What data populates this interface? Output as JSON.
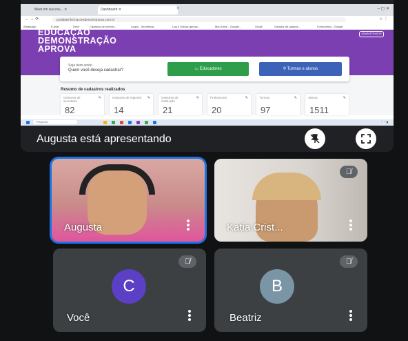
{
  "browser": {
    "tabs": [
      "Meet em sua reu...",
      "Dashboard"
    ],
    "url": "portaldeinformacoesdemonstracao.com.br",
    "bookmarks": [
      "WhatsApp",
      "E-mail",
      "Drive",
      "Cadastro de servido...",
      "Logon - Secretaria...",
      "Log it | Iniciar gerenc...",
      "Meu Drive - Google...",
      "Gmail",
      "Gerador de palavra...",
      "Formulários - Google"
    ]
  },
  "site": {
    "title": "EDUCAÇÃO\nDEMONSTRAÇÃO\nAPROVA",
    "account_button": "ADMINISTRADOR",
    "greeting": "Seja bem-vindo",
    "question": "Quem você deseja cadastrar?",
    "btn_educadores": "Educadores",
    "btn_turmas": "Turmas e alunos",
    "resumo_title": "Resumo de cadastros realizados",
    "stats": [
      {
        "label": "Gestores de secretaria",
        "value": "82"
      },
      {
        "label": "Gestores de regional",
        "value": "14"
      },
      {
        "label": "Gestores de instituição",
        "value": "21"
      },
      {
        "label": "Professores",
        "value": "20"
      },
      {
        "label": "Turmas",
        "value": "97"
      },
      {
        "label": "Alunos",
        "value": "1511"
      }
    ],
    "search_placeholder": "Pesquisar"
  },
  "meet": {
    "presenting_text": "Augusta está apresentando",
    "participants": [
      {
        "name": "Augusta",
        "speaking": true,
        "muted": false,
        "video": true
      },
      {
        "name": "Katia Crist...",
        "speaking": false,
        "muted": true,
        "video": true
      },
      {
        "name": "Você",
        "initial": "C",
        "avatar_color": "#5b3fc4",
        "muted": true,
        "video": false
      },
      {
        "name": "Beatriz",
        "initial": "B",
        "avatar_color": "#7a95a6",
        "muted": true,
        "video": false
      }
    ]
  }
}
